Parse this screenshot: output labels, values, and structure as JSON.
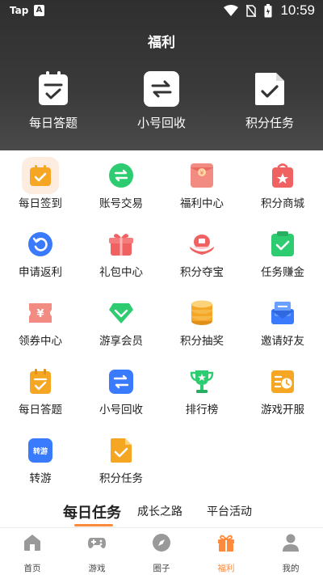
{
  "status": {
    "carrier": "Tap",
    "time": "10:59"
  },
  "header": {
    "title": "福利"
  },
  "quick": [
    {
      "label": "每日答题",
      "icon": "clipboard-check-icon"
    },
    {
      "label": "小号回收",
      "icon": "swap-arrows-icon"
    },
    {
      "label": "积分任务",
      "icon": "document-check-icon"
    }
  ],
  "grid": [
    {
      "label": "每日签到",
      "icon": "calendar-check-icon",
      "color": "#f5a623"
    },
    {
      "label": "账号交易",
      "icon": "exchange-icon",
      "color": "#2ecc71"
    },
    {
      "label": "福利中心",
      "icon": "red-envelope-icon",
      "color": "#f28b82"
    },
    {
      "label": "积分商城",
      "icon": "shopping-bag-icon",
      "color": "#f06262"
    },
    {
      "label": "申请返利",
      "icon": "refund-icon",
      "color": "#3a7bfd"
    },
    {
      "label": "礼包中心",
      "icon": "gift-icon",
      "color": "#f06262"
    },
    {
      "label": "积分夺宝",
      "icon": "treasure-icon",
      "color": "#f06262"
    },
    {
      "label": "任务赚金",
      "icon": "task-icon",
      "color": "#2ecc71"
    },
    {
      "label": "领券中心",
      "icon": "coupon-icon",
      "color": "#f28b82"
    },
    {
      "label": "游享会员",
      "icon": "diamond-icon",
      "color": "#2ecc71"
    },
    {
      "label": "积分抽奖",
      "icon": "coins-icon",
      "color": "#f5a623"
    },
    {
      "label": "邀请好友",
      "icon": "mail-icon",
      "color": "#3a7bfd"
    },
    {
      "label": "每日答题",
      "icon": "clipboard-check-icon",
      "color": "#f5a623"
    },
    {
      "label": "小号回收",
      "icon": "swap-arrows-icon",
      "color": "#3a7bfd"
    },
    {
      "label": "排行榜",
      "icon": "trophy-icon",
      "color": "#2ecc71"
    },
    {
      "label": "游戏开服",
      "icon": "server-clock-icon",
      "color": "#f5a623"
    },
    {
      "label": "转游",
      "icon": "transfer-game-icon",
      "color": "#3a7bfd",
      "badge": "转游"
    },
    {
      "label": "积分任务",
      "icon": "document-check-icon",
      "color": "#f5a623"
    }
  ],
  "tabs": [
    {
      "label": "每日任务"
    },
    {
      "label": "成长之路"
    },
    {
      "label": "平台活动"
    }
  ],
  "nav": [
    {
      "label": "首页",
      "icon": "home-icon"
    },
    {
      "label": "游戏",
      "icon": "gamepad-icon"
    },
    {
      "label": "圈子",
      "icon": "compass-icon"
    },
    {
      "label": "福利",
      "icon": "gift-icon"
    },
    {
      "label": "我的",
      "icon": "user-icon"
    }
  ],
  "colors": {
    "accent": "#ff8a3c",
    "header_bg": "#3a3a3a"
  }
}
